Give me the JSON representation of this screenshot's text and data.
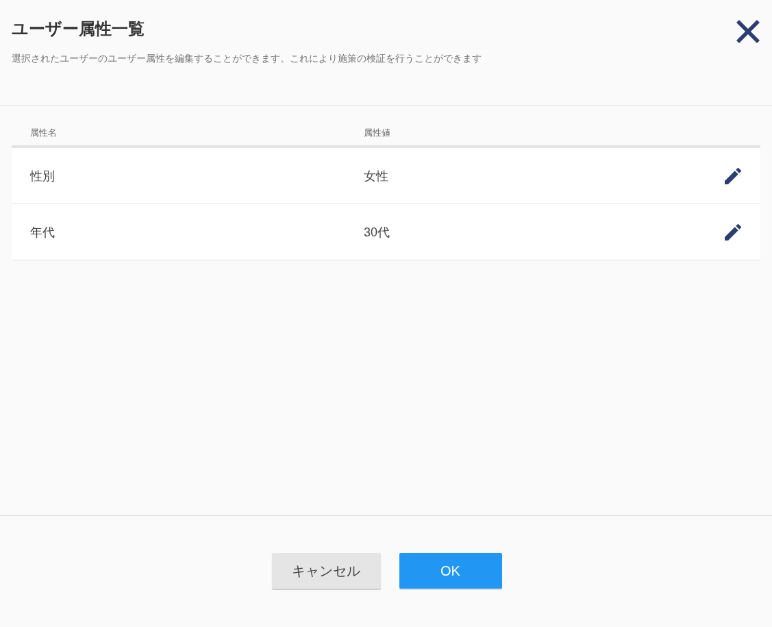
{
  "dialog": {
    "title": "ユーザー属性一覧",
    "description": "選択されたユーザーのユーザー属性を編集することができます。これにより施策の検証を行うことができます"
  },
  "table": {
    "columns": [
      "属性名",
      "属性値"
    ],
    "rows": [
      {
        "name": "性別",
        "value": "女性"
      },
      {
        "name": "年代",
        "value": "30代"
      }
    ]
  },
  "buttons": [
    {
      "label": "キャンセル",
      "kind": "secondary"
    },
    {
      "label": "OK",
      "kind": "primary"
    }
  ]
}
